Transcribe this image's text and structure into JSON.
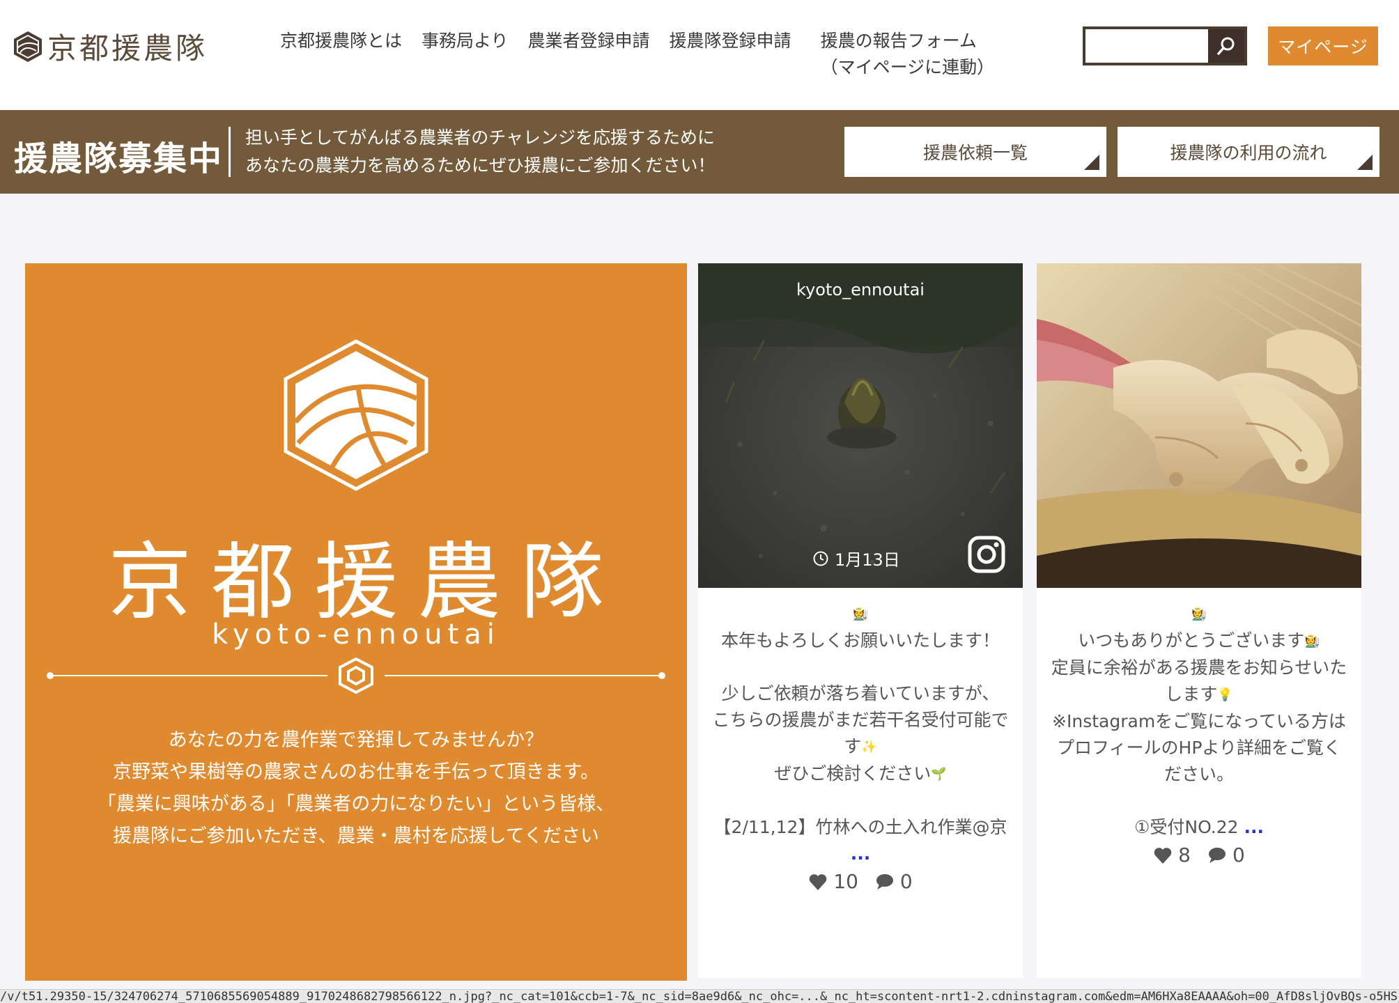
{
  "header": {
    "logo_text": "京都援農隊",
    "nav": [
      {
        "label": "京都援農隊とは"
      },
      {
        "label": "事務局より"
      },
      {
        "label": "農業者登録申請"
      },
      {
        "label": "援農隊登録申請"
      }
    ],
    "nav_report": {
      "line1": "援農の報告フォーム",
      "line2": "（マイページに連動）"
    },
    "search": {
      "value": "",
      "placeholder": ""
    },
    "mypage_label": "マイページ"
  },
  "banner": {
    "title": "援農隊募集中",
    "text_line1": "担い手としてがんばる農業者のチャレンジを応援するために",
    "text_line2": "あなたの農業力を高めるためにぜひ援農にご参加ください！",
    "btn_requests": "援農依頼一覧",
    "btn_flow": "援農隊の利用の流れ"
  },
  "hero": {
    "brand": "京都援農隊",
    "roman": "kyoto-ennoutai",
    "desc": [
      "あなたの力を農作業で発揮してみませんか？",
      "京野菜や果樹等の農家さんのお仕事を手伝って頂きます。",
      "「農業に興味がある」「農業者の力になりたい」という皆様、",
      "援農隊にご参加いただき、農業・農村を応援してください"
    ]
  },
  "posts": [
    {
      "username": "kyoto_ennoutai",
      "date": "1月13日",
      "lines": [
        "本年もよろしくお願いいたします！",
        " ",
        "少しご依頼が落ち着いていますが、",
        "こちらの援農がまだ若干名受付可能で",
        "す",
        "ぜひご検討ください",
        " ",
        "【2/11,12】竹林への土入れ作業@京"
      ],
      "more": "...",
      "likes": "10",
      "comments": "0"
    },
    {
      "lines": [
        "いつもありがとうございます",
        "定員に余裕がある援農をお知らせいた",
        "します",
        "※Instagramをご覧になっている方は",
        "プロフィールのHPより詳細をご覧く",
        "ださい。",
        " ",
        "①受付NO.22"
      ],
      "more": "...",
      "likes": "8",
      "comments": "0"
    }
  ],
  "status_url": "/v/t51.29350-15/324706274_5710685569054889_9170248682798566122_n.jpg?_nc_cat=101&ccb=1-7&_nc_sid=8ae9d6&_nc_ohc=...&_nc_ht=scontent-nrt1-2.cdninstagram.com&edm=AM6HXa8EAAAA&oh=00_AfD8sljOvBQs-o5HSjFgHeZ0buauUF9AI",
  "colors": {
    "accent_orange": "#e08a30",
    "banner_brown": "#725a3a",
    "dark_brown": "#3e3028",
    "link_blue": "#2233cc"
  }
}
